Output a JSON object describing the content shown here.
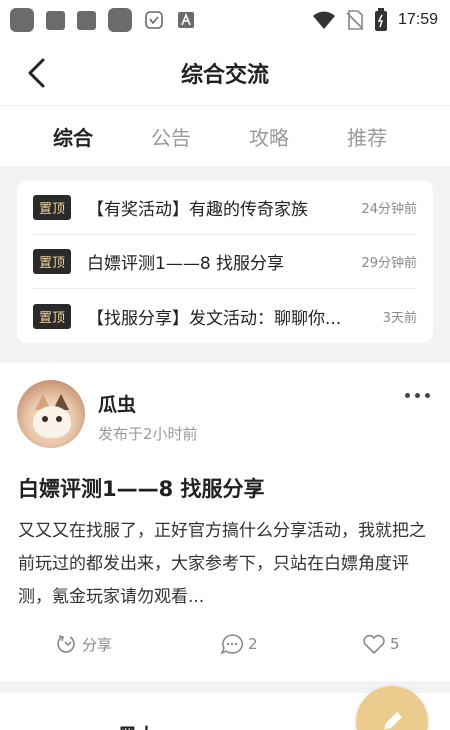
{
  "status_bar": {
    "time": "17:59"
  },
  "header": {
    "title": "综合交流"
  },
  "tabs": [
    {
      "label": "综合",
      "active": true
    },
    {
      "label": "公告",
      "active": false
    },
    {
      "label": "攻略",
      "active": false
    },
    {
      "label": "推荐",
      "active": false
    }
  ],
  "pinned": [
    {
      "tag": "置顶",
      "title": "【有奖活动】有趣的传奇家族",
      "time": "24分钟前"
    },
    {
      "tag": "置顶",
      "title": "白嫖评测1——8 找服分享",
      "time": "29分钟前"
    },
    {
      "tag": "置顶",
      "title": "【找服分享】发文活动：聊聊你...",
      "time": "3天前"
    }
  ],
  "post": {
    "author": "瓜虫",
    "time": "发布于2小时前",
    "title": "白嫖评测1——8 找服分享",
    "body": "又又又在找服了，正好官方搞什么分享活动，我就把之前玩过的都发出来，大家参考下，只站在白嫖角度评测，氪金玩家请勿观看...",
    "share_label": "分享",
    "comment_count": "2",
    "like_count": "5"
  },
  "next_post": {
    "author": "黑大"
  },
  "colors": {
    "tag_bg": "#2a2a2a",
    "tag_text": "#f2d39c",
    "fab": "#eccb8e"
  }
}
